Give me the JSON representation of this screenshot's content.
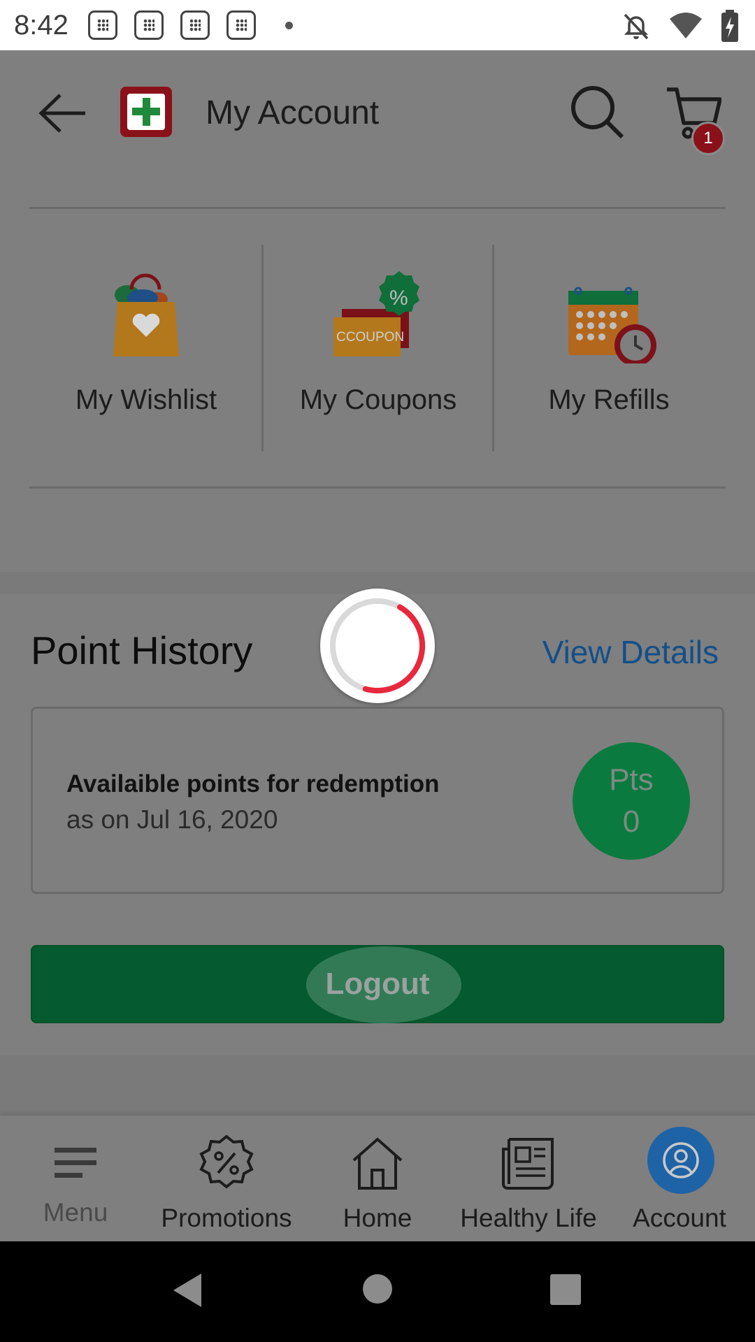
{
  "status_bar": {
    "time": "8:42"
  },
  "app_bar": {
    "title": "My Account",
    "cart_count": "1"
  },
  "quick_links": [
    {
      "label": "My Wishlist",
      "icon": "shopping-bag-heart-icon"
    },
    {
      "label": "My Coupons",
      "icon": "coupon-icon"
    },
    {
      "label": "My Refills",
      "icon": "calendar-clock-icon"
    }
  ],
  "points": {
    "title": "Point History",
    "view_details": "View Details",
    "label": "Availaible points for redemption",
    "date": "as on Jul 16, 2020",
    "pts_label": "Pts",
    "pts_value": "0"
  },
  "logout": {
    "label": "Logout"
  },
  "coupon_icon_text": "CCOUPON",
  "bottom_nav": [
    {
      "label": "Menu",
      "icon": "hamburger-menu-icon"
    },
    {
      "label": "Promotions",
      "icon": "percent-badge-icon"
    },
    {
      "label": "Home",
      "icon": "home-icon"
    },
    {
      "label": "Healthy Life",
      "icon": "newspaper-icon"
    },
    {
      "label": "Account",
      "icon": "user-circle-icon",
      "active": true
    }
  ],
  "colors": {
    "brand_red": "#8a1119",
    "brand_green": "#0a7a3e",
    "link_blue": "#134f8a",
    "active_nav": "#1e63a6"
  }
}
